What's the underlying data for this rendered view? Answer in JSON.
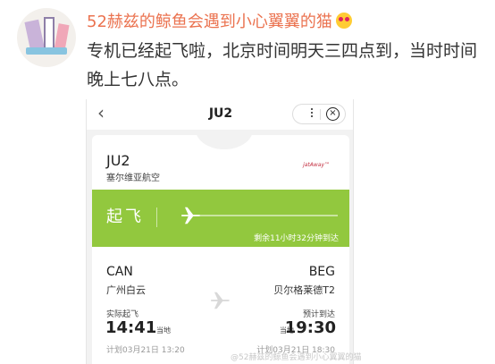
{
  "post": {
    "username": "52赫兹的鲸鱼会遇到小心翼翼的猫",
    "emoji_icon": "heart-eyes-emoji-icon",
    "text": "专机已经起飞啦，北京时间明天三四点到，当时时间晚上七八点。"
  },
  "miniprogram": {
    "title": "JU2",
    "back_icon": "chevron-left-icon",
    "more_icon": "more-dots-icon",
    "close_icon": "close-circle-icon"
  },
  "flight": {
    "code": "JU2",
    "airline": "塞尔维亚航空",
    "airline_logo_text": "jatAway™",
    "status": "起飞",
    "remaining": "剩余11小时32分钟到达",
    "departure": {
      "code": "CAN",
      "name": "广州白云",
      "time_label": "实际起飞",
      "time": "14:41",
      "tz": "当地",
      "scheduled": "计划03月21日 13:20"
    },
    "arrival": {
      "code": "BEG",
      "name": "贝尔格莱德T2",
      "time_label": "预计到达",
      "time": "19:30",
      "tz": "当地",
      "scheduled": "计划03月21日 18:30"
    }
  },
  "watermark": "@52赫兹的鲸鱼会遇到小心翼翼的猫",
  "colors": {
    "username": "#eb7350",
    "status_band": "#92c83e",
    "text": "#333333"
  }
}
